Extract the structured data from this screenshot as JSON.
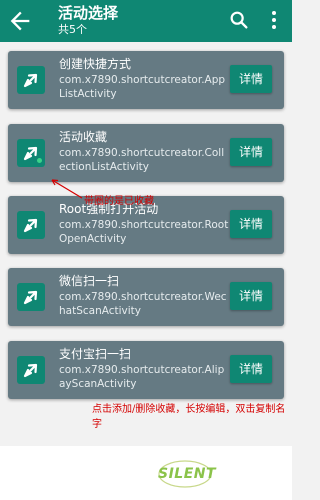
{
  "appbar": {
    "title": "活动选择",
    "subtitle": "共5个",
    "back_icon": "arrow-left-icon",
    "search_icon": "search-icon",
    "more_icon": "more-vert-icon"
  },
  "colors": {
    "primary": "#0f8773",
    "card": "#657a83",
    "annotation": "#d40000"
  },
  "activities": [
    {
      "name": "创建快捷方式",
      "class": "com.x7890.shortcutcreator.AppListActivity",
      "detail": "详情",
      "favorited": false
    },
    {
      "name": "活动收藏",
      "class": "com.x7890.shortcutcreator.CollectionListActivity",
      "detail": "详情",
      "favorited": true
    },
    {
      "name": "Root强制打开活动",
      "class": "com.x7890.shortcutcreator.RootOpenActivity",
      "detail": "详情",
      "favorited": false
    },
    {
      "name": "微信扫一扫",
      "class": "com.x7890.shortcutcreator.WechatScanActivity",
      "detail": "详情",
      "favorited": false
    },
    {
      "name": "支付宝扫一扫",
      "class": "com.x7890.shortcutcreator.AlipayScanActivity",
      "detail": "详情",
      "favorited": false
    }
  ],
  "annotations": {
    "favorite_note": "带圈的是已收藏",
    "usage_note": "点击添加/删除收藏，长按编辑，双击复制名字"
  },
  "watermark": {
    "text": "SILENT"
  }
}
